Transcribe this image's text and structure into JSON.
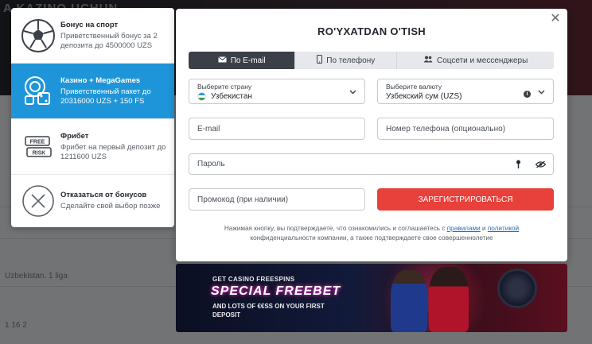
{
  "background": {
    "banner_text": "A KAZINO UCHUN",
    "row_label_1": "Uzbekistan. 1 liga",
    "row_label_2": "1 16 2"
  },
  "bonus_panel": {
    "items": [
      {
        "title": "Бонус на спорт",
        "desc": "Приветственный бонус за 2 депозита до 4500000 UZS",
        "icon": "soccer-ball-icon"
      },
      {
        "title": "Казино + MegaGames",
        "desc": "Приветственный пакет до 20316000 UZS + 150 FS",
        "icon": "casino-chips-icon"
      },
      {
        "title": "Фрибет",
        "desc": "Фрибет на первый депозит до 1211600 UZS",
        "icon": "free-risk-icon"
      },
      {
        "title": "Отказаться от бонусов",
        "desc": "Сделайте свой выбор позже",
        "icon": "cancel-circle-icon"
      }
    ]
  },
  "modal": {
    "title": "RO'YXATDAN O'TISH",
    "tabs": [
      {
        "label": "По E-mail",
        "icon": "envelope-icon"
      },
      {
        "label": "По телефону",
        "icon": "phone-icon"
      },
      {
        "label": "Соцсети и мессенджеры",
        "icon": "users-icon"
      }
    ],
    "country": {
      "label": "Выберите страну",
      "value": "Узбекистан"
    },
    "currency": {
      "label": "Выберите валюту",
      "value": "Узбекский сум (UZS)"
    },
    "email_placeholder": "E-mail",
    "phone_placeholder": "Номер телефона (опционально)",
    "password_placeholder": "Пароль",
    "promo_placeholder": "Промокод (при наличии)",
    "submit_label": "ЗАРЕГИСТРИРОВАТЬСЯ",
    "disclaimer": {
      "part1": "Нажимая кнопку, вы подтверждаете, что ознакомились и соглашаетесь с ",
      "link1": "правилами",
      "part2": " и ",
      "link2": "политикой",
      "part3": " конфиденциальности компании, а также подтверждаете свое совершеннолетие"
    }
  },
  "promo_banner": {
    "line1": "GET CASINO FREESPINS",
    "line2": "SPECIAL FREEBET",
    "line3": "AND LOTS OF €€SS ON YOUR FIRST DEPOSIT"
  },
  "colors": {
    "accent_blue": "#1e95d8",
    "submit_red": "#e8403a",
    "tab_dark": "#3b4048"
  }
}
